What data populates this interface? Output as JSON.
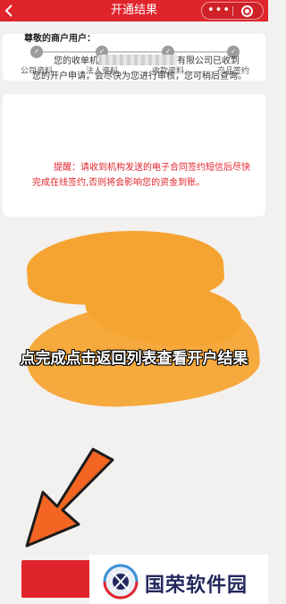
{
  "navbar": {
    "title": "开通结果",
    "back_icon": "chevron-left-icon",
    "more_icon": "more-dots-icon",
    "close_icon": "close-circle-icon"
  },
  "steps": [
    {
      "label": "公司资料",
      "status": "done"
    },
    {
      "label": "法人资料",
      "status": "done"
    },
    {
      "label": "收款资料",
      "status": "done"
    },
    {
      "label": "产品签约",
      "status": "done"
    }
  ],
  "message": {
    "greeting": "尊敬的商户用户：",
    "body_before": "您的收单机",
    "body_after": "有限公司已收到您的开户申请，会尽快为您进行审核，您可稍后查询。",
    "reminder": "提醒：请收到机构发送的电子合同签约短信后尽快完成在线签约,否则将会影响您的资金到账。"
  },
  "annotation": {
    "instruction": "点完成点击返回列表查看开户结果"
  },
  "bottom_button": {
    "label": ""
  },
  "watermark": {
    "text": "国荣软件园"
  },
  "colors": {
    "primary_red": "#e0242c",
    "highlight_orange": "#f5a432",
    "arrow_orange": "#f26522",
    "page_bg": "#f2f1f0"
  }
}
